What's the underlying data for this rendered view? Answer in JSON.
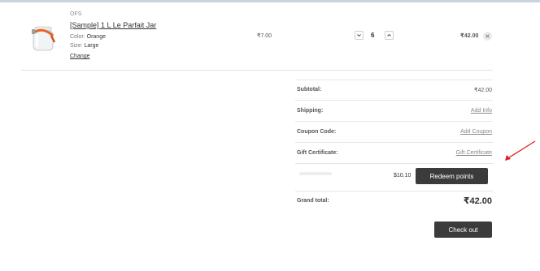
{
  "item": {
    "brand": "OFS",
    "name": "[Sample] 1 L Le Parfait Jar",
    "color_label": "Color:",
    "color_value": "Orange",
    "size_label": "Size:",
    "size_value": "Large",
    "change_label": "Change",
    "price": "₹7.00",
    "quantity": "6",
    "total": "₹42.00",
    "image_icon": "jar-image",
    "remove_icon": "close-icon"
  },
  "totals": {
    "subtotal_label": "Subtotal:",
    "subtotal_value": "₹42.00",
    "shipping_label": "Shipping:",
    "shipping_link": "Add Info",
    "coupon_label": "Coupon Code:",
    "coupon_link": "Add Coupon",
    "gift_label": "Gift Certificate:",
    "gift_link": "Gift Certificate",
    "points_value": "$10.10",
    "redeem_label": "Redeem points",
    "grand_label": "Grand total:",
    "grand_value": "₹42.00"
  },
  "checkout_label": "Check out",
  "colors": {
    "button_bg": "#3b3b3b",
    "annotation_arrow": "#e02020",
    "jar_lid": "#e8622c"
  }
}
